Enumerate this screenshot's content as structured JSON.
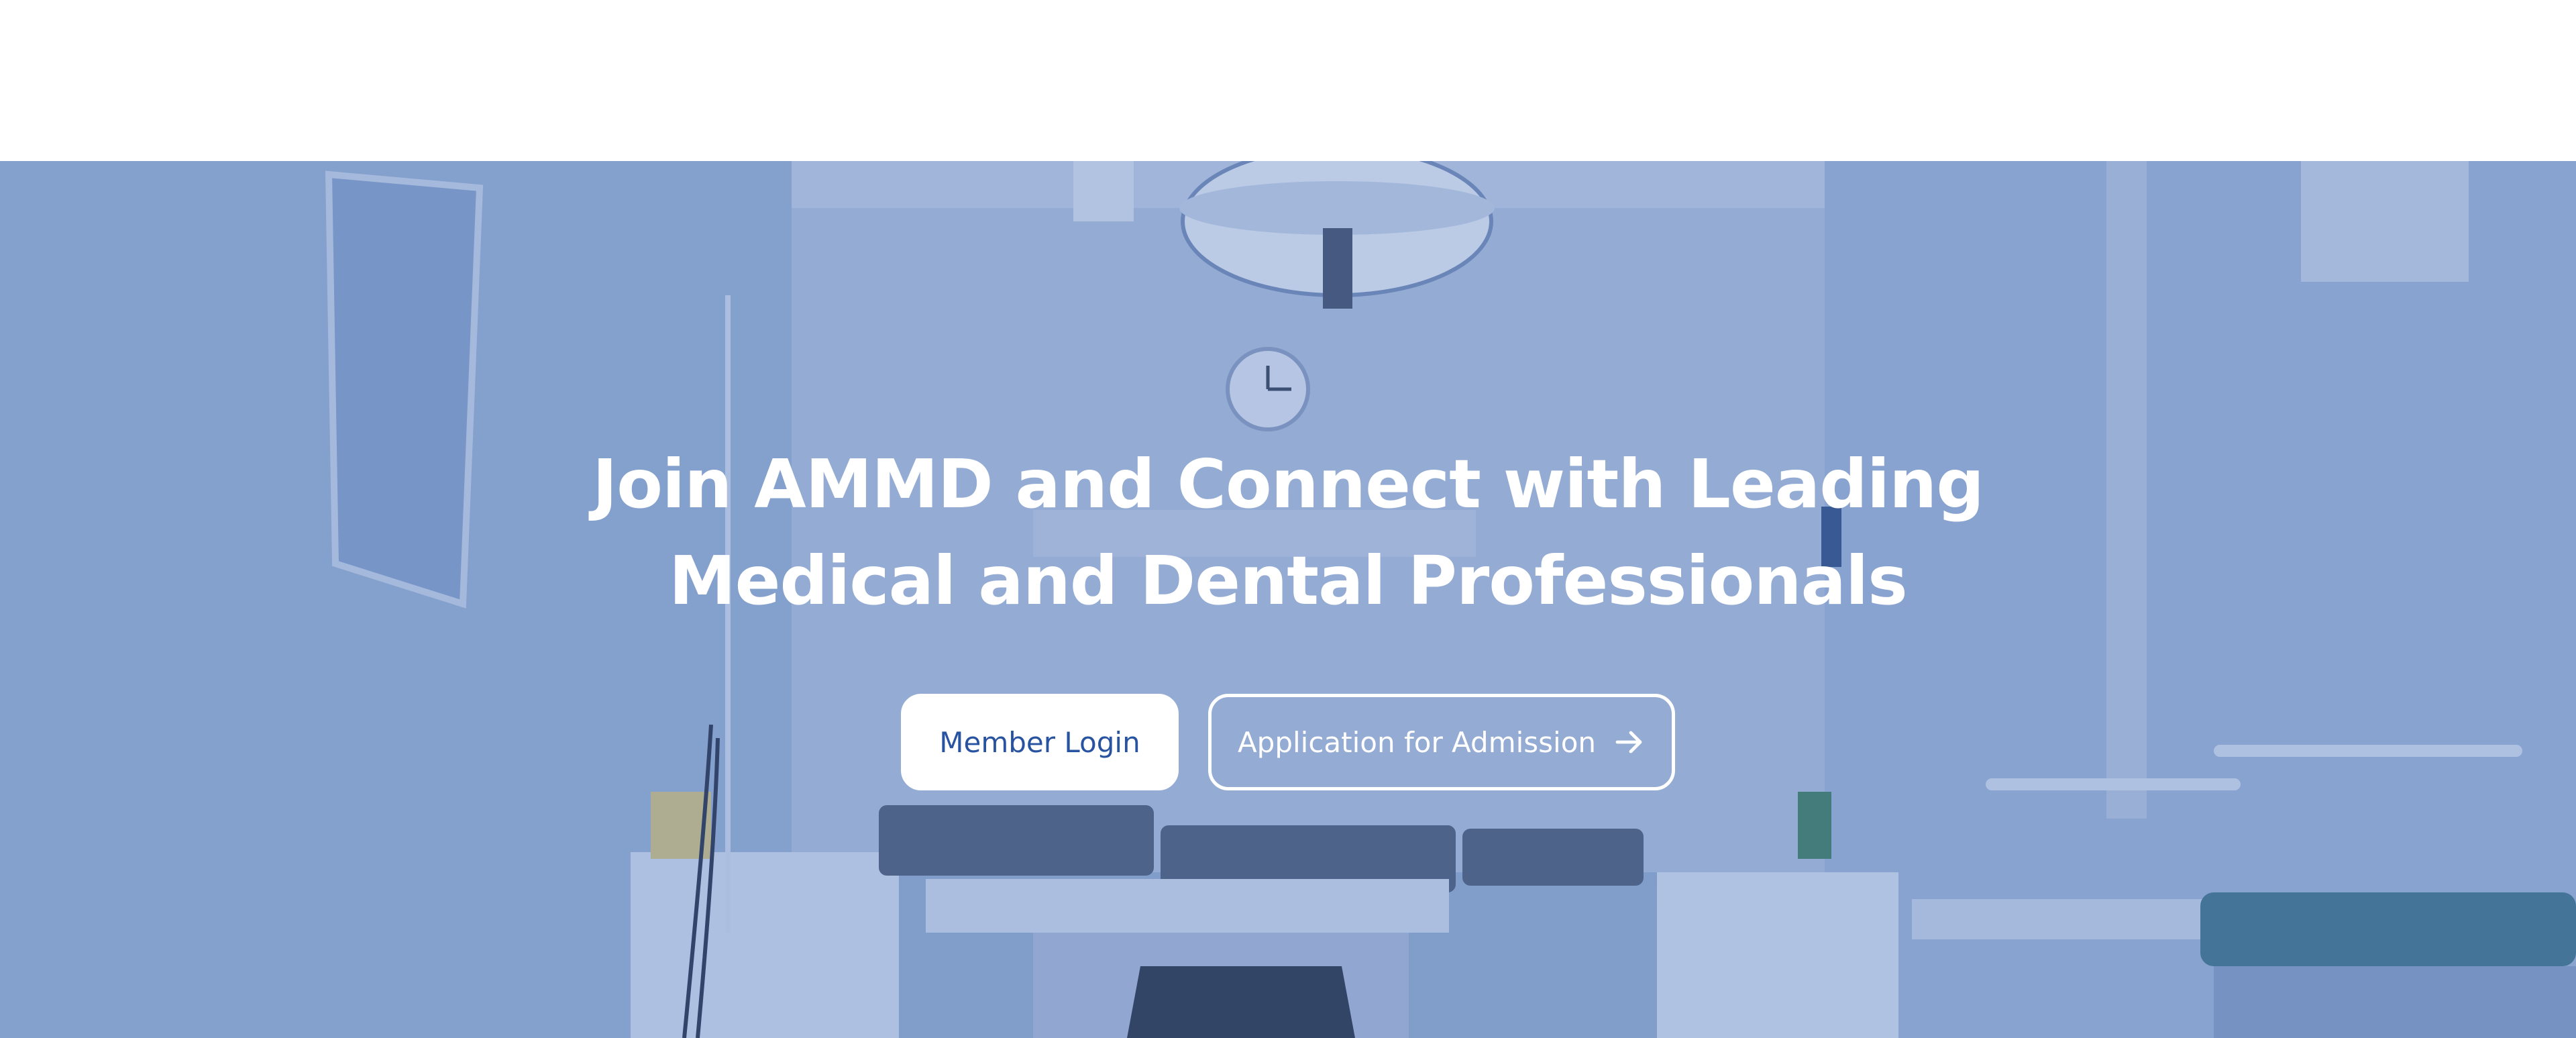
{
  "hero": {
    "title": "Join AMMD and Connect with Leading Medical and Dental Professionals",
    "background_description_icon": "operating-room-photo",
    "overlay_color": "#5f82be",
    "buttons": {
      "login_label": "Member Login",
      "apply_label": "Application for Admission",
      "apply_icon": "arrow-right-icon"
    }
  },
  "colors": {
    "accent": "#2753a0",
    "hero_tint": "#8aa3cc",
    "text_on_hero": "#ffffff"
  }
}
